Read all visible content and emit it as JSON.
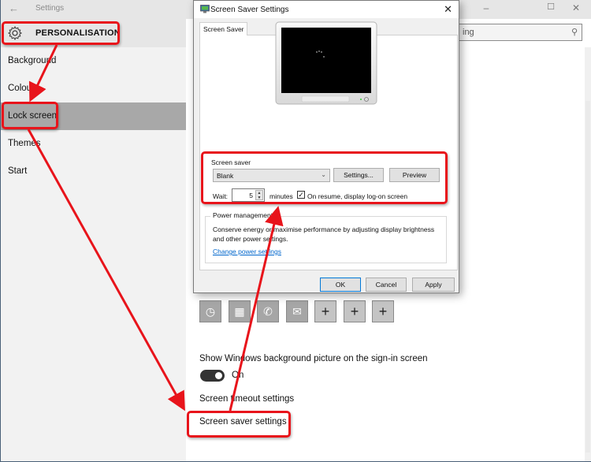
{
  "settings_window": {
    "title": "Settings",
    "back_icon": "back-arrow-icon",
    "controls": {
      "minimize": "minimize-icon",
      "maximize": "maximize-icon",
      "close": "close-icon"
    },
    "section_title": "PERSONALISATION",
    "section_icon": "gear-icon",
    "nav": [
      {
        "label": "Background",
        "active": false
      },
      {
        "label": "Colours",
        "active": false
      },
      {
        "label": "Lock screen",
        "active": true
      },
      {
        "label": "Themes",
        "active": false
      },
      {
        "label": "Start",
        "active": false
      }
    ],
    "search": {
      "visible_text": "ing",
      "icon": "search-icon"
    },
    "main": {
      "app_tiles": [
        {
          "icon": "alarm-clock-icon",
          "glyph": "◷"
        },
        {
          "icon": "calendar-icon",
          "glyph": "▦"
        },
        {
          "icon": "phone-icon",
          "glyph": "✆"
        },
        {
          "icon": "mail-icon",
          "glyph": "✉"
        },
        {
          "icon": "plus-icon",
          "glyph": "+"
        },
        {
          "icon": "plus-icon",
          "glyph": "+"
        },
        {
          "icon": "plus-icon",
          "glyph": "+"
        }
      ],
      "background_picture_label": "Show Windows background picture on the sign-in screen",
      "toggle_state": "On",
      "screen_timeout_link": "Screen timeout settings",
      "screen_saver_link": "Screen saver settings"
    }
  },
  "dialog": {
    "title": "Screen Saver Settings",
    "close_glyph": "✕",
    "tab": "Screen Saver",
    "screen_saver_group": {
      "label": "Screen saver",
      "selected": "Blank",
      "settings_button": "Settings...",
      "preview_button": "Preview",
      "wait_label": "Wait:",
      "wait_value": "5",
      "minutes_label": "minutes",
      "resume_checked": true,
      "resume_label": "On resume, display log-on screen"
    },
    "power_group": {
      "label": "Power management",
      "description": "Conserve energy or maximise performance by adjusting display brightness and other power settings.",
      "link": "Change power settings"
    },
    "buttons": {
      "ok": "OK",
      "cancel": "Cancel",
      "apply": "Apply"
    }
  },
  "annotations": {
    "color": "#e8141b"
  }
}
